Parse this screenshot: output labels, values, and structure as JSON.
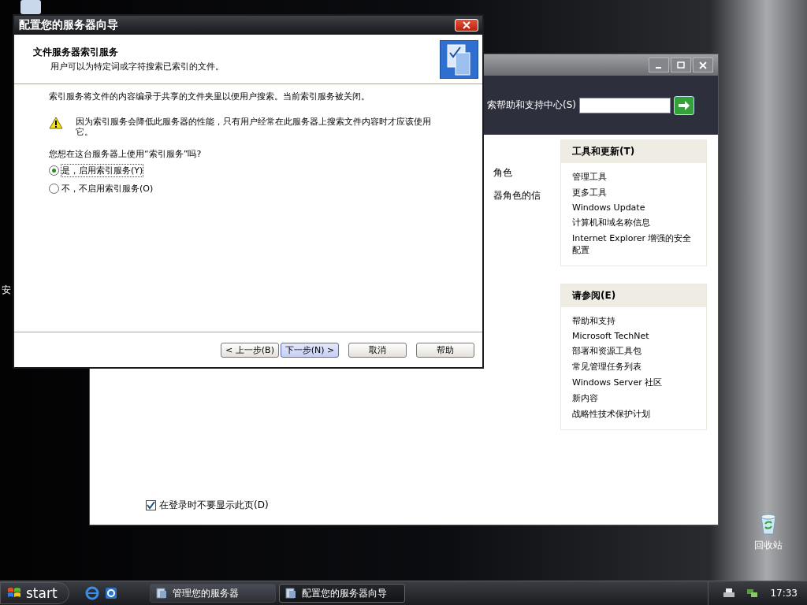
{
  "desktop": {
    "cut_label": "安",
    "icons": [
      {
        "label": "回收站"
      }
    ]
  },
  "background_window": {
    "search": {
      "label": "索帮助和支持中心(S)"
    },
    "fragments": [
      "角色",
      "器角色的信"
    ],
    "panels": [
      {
        "title": "工具和更新(T)",
        "links": [
          "管理工具",
          "更多工具",
          "Windows Update",
          "计算机和域名称信息",
          "Internet Explorer 增强的安全配置"
        ]
      },
      {
        "title": "请参阅(E)",
        "links": [
          "帮助和支持",
          "Microsoft TechNet",
          "部署和资源工具包",
          "常见管理任务列表",
          "Windows Server 社区",
          "新内容",
          "战略性技术保护计划"
        ]
      }
    ],
    "checkbox": {
      "label": "在登录时不要显示此页(D)",
      "checked": true
    }
  },
  "dialog": {
    "title": "配置您的服务器向导",
    "heading": "文件服务器索引服务",
    "subheading": "用户可以为特定词或字符搜索已索引的文件。",
    "description": "索引服务将文件的内容编录于共享的文件夹里以便用户搜索。当前索引服务被关闭。",
    "warning": "因为索引服务会降低此服务器的性能，只有用户经常在此服务器上搜索文件内容时才应该使用它。",
    "question": "您想在这台服务器上使用“索引服务”吗?",
    "options": [
      {
        "label": "是，启用索引服务(Y)",
        "selected": true
      },
      {
        "label": "不，不启用索引服务(O)",
        "selected": false
      }
    ],
    "buttons": [
      {
        "label": "< 上一步(B)",
        "default": false
      },
      {
        "label": "下一步(N) >",
        "default": true
      },
      {
        "label": "取消",
        "default": false
      },
      {
        "label": "帮助",
        "default": false
      }
    ]
  },
  "taskbar": {
    "start": "start",
    "tasks": [
      {
        "label": "管理您的服务器",
        "selected": false
      },
      {
        "label": "配置您的服务器向导",
        "selected": true
      }
    ],
    "clock": "17:33"
  }
}
